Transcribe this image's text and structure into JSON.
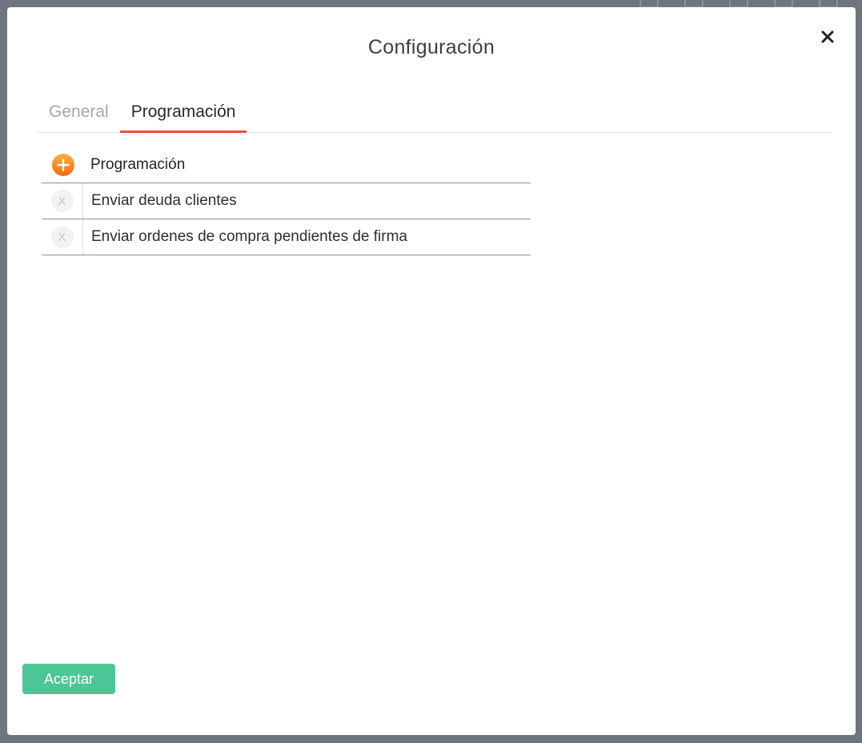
{
  "modal": {
    "title": "Configuración",
    "close_icon": "close-icon"
  },
  "tabs": [
    {
      "label": "General",
      "active": false
    },
    {
      "label": "Programación",
      "active": true
    }
  ],
  "schedule": {
    "header_label": "Programación",
    "add_icon": "plus-circle-icon",
    "rows": [
      {
        "label": "Enviar deuda clientes",
        "remove_glyph": "X"
      },
      {
        "label": "Enviar ordenes de compra pendientes de firma",
        "remove_glyph": "X"
      }
    ]
  },
  "footer": {
    "accept_label": "Aceptar"
  },
  "colors": {
    "accent_tab": "#e8533a",
    "accept_button": "#4cc597",
    "add_icon": "#f7941d"
  }
}
